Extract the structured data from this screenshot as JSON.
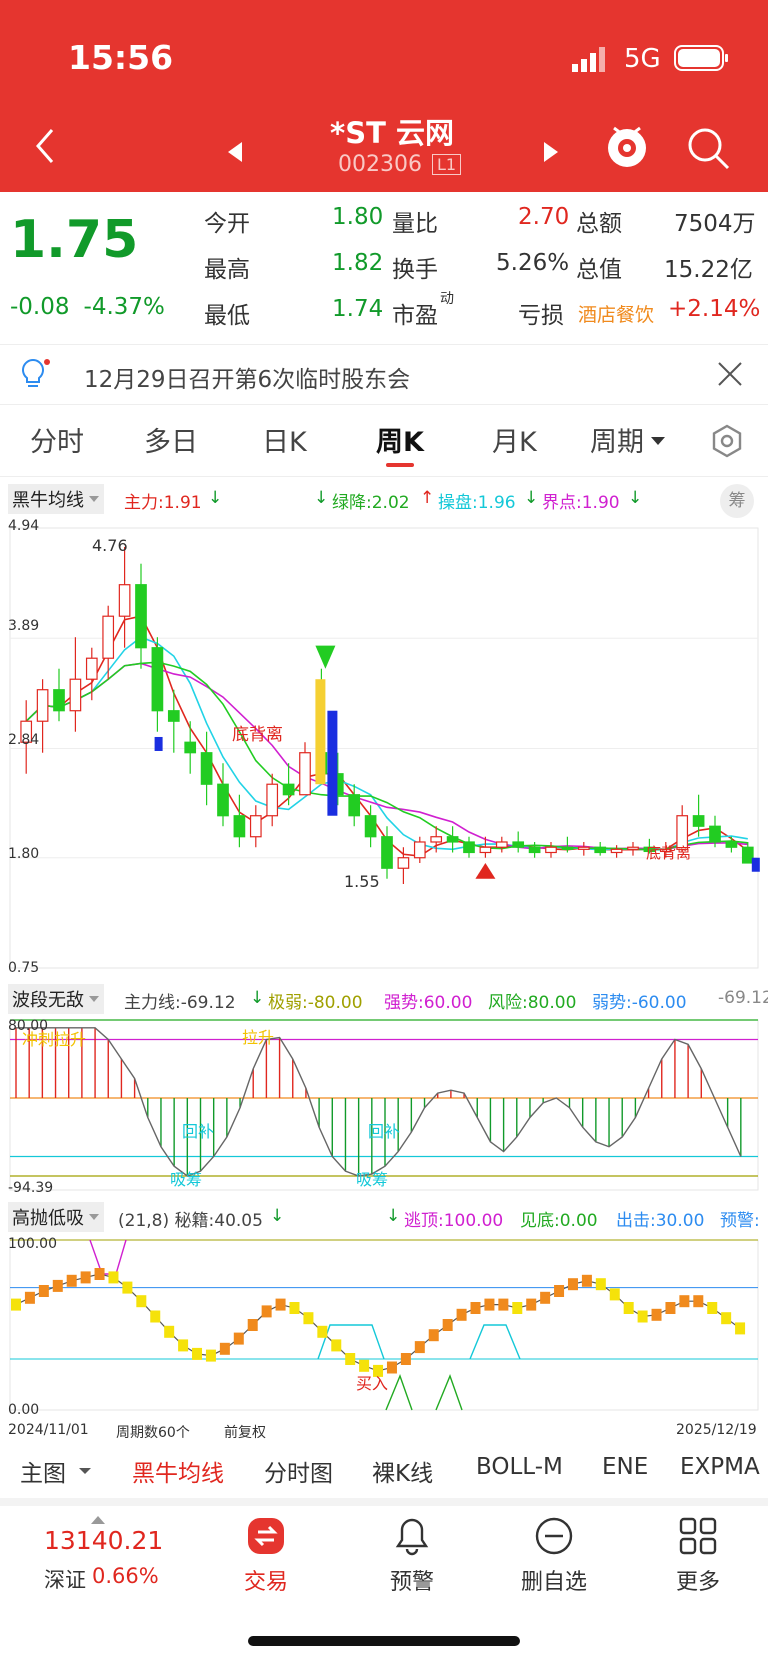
{
  "status": {
    "time": "15:56",
    "network": "5G"
  },
  "header": {
    "title": "*ST 云网",
    "code": "002306",
    "level": "L1"
  },
  "quote": {
    "price": "1.75",
    "change": "-0.08",
    "change_pct": "-4.37%",
    "open_label": "今开",
    "open": "1.80",
    "high_label": "最高",
    "high": "1.82",
    "low_label": "最低",
    "low": "1.74",
    "vr_label": "量比",
    "vr": "2.70",
    "turnover_label": "换手",
    "turnover": "5.26%",
    "pe_label": "市盈",
    "pe_sup": "动",
    "pe": "亏损",
    "amount_label": "总额",
    "amount": "7504万",
    "mcap_label": "总值",
    "mcap": "15.22亿",
    "sector": "酒店餐饮",
    "sector_pct": "+2.14%"
  },
  "notice": {
    "text": "12月29日召开第6次临时股东会"
  },
  "tabs": [
    "分时",
    "多日",
    "日K",
    "周K",
    "月K",
    "周期"
  ],
  "active_tab": 3,
  "main_chart": {
    "indicator": "黑牛均线",
    "zhuli": "主力:1.91",
    "lvjiang": "绿降:2.02",
    "caopan": "操盘:1.96",
    "jiedian": "界点:1.90",
    "chou": "筹",
    "y_labels": [
      "4.94",
      "3.89",
      "2.84",
      "1.80",
      "0.75"
    ],
    "high_mark": "4.76",
    "low_mark": "1.55",
    "annotations": [
      "底背离",
      "底背离"
    ]
  },
  "osc1": {
    "name": "波段无敌",
    "zhuli": "主力线:-69.12",
    "jiruo": "极弱:-80.00",
    "qiangshi": "强势:60.00",
    "fengxian": "风险:80.00",
    "ruoshi": "弱势:-60.00",
    "tail": "-69.12",
    "top": "80.00",
    "bottom": "-94.39",
    "tags": [
      "冲刺拉升",
      "拉升",
      "回补",
      "回补",
      "吸筹",
      "吸筹"
    ]
  },
  "osc2": {
    "name": "高抛低吸",
    "param": "(21,8) 秘籍:40.05",
    "taoding": "逃顶:100.00",
    "jiandi": "见底:0.00",
    "chuji": "出击:30.00",
    "yujing": "预警:",
    "top": "100.00",
    "bottom": "0.00",
    "tag": "买入"
  },
  "date_bar": {
    "start": "2024/11/01",
    "count": "周期数60个",
    "adj": "前复权",
    "end": "2025/12/19"
  },
  "indicator_tabs": [
    "主图",
    "黑牛均线",
    "分时图",
    "裸K线",
    "BOLL-M",
    "ENE",
    "EXPMA"
  ],
  "bottom_nav": {
    "index_value": "13140.21",
    "index_name": "深证",
    "index_pct": "0.66%",
    "trade": "交易",
    "alert": "预警",
    "remove": "删自选",
    "more": "更多"
  },
  "chart_data": {
    "type": "candlestick",
    "title": "*ST 云网 周K",
    "ylim": [
      0.75,
      4.94
    ],
    "ohlc": [
      [
        2.9,
        3.3,
        2.6,
        3.1
      ],
      [
        3.1,
        3.5,
        2.8,
        3.4
      ],
      [
        3.4,
        3.6,
        3.1,
        3.2
      ],
      [
        3.2,
        3.9,
        3.0,
        3.5
      ],
      [
        3.5,
        3.8,
        3.3,
        3.7
      ],
      [
        3.7,
        4.2,
        3.5,
        4.1
      ],
      [
        4.1,
        4.76,
        3.8,
        4.4
      ],
      [
        4.4,
        4.6,
        3.6,
        3.8
      ],
      [
        3.8,
        3.9,
        3.0,
        3.2
      ],
      [
        3.2,
        3.4,
        2.8,
        3.1
      ],
      [
        2.9,
        3.1,
        2.6,
        2.8
      ],
      [
        2.8,
        3.0,
        2.3,
        2.5
      ],
      [
        2.5,
        2.7,
        2.1,
        2.2
      ],
      [
        2.2,
        2.4,
        1.9,
        2.0
      ],
      [
        2.0,
        2.3,
        1.9,
        2.2
      ],
      [
        2.2,
        2.6,
        2.1,
        2.5
      ],
      [
        2.5,
        2.7,
        2.3,
        2.4
      ],
      [
        2.4,
        2.9,
        2.4,
        2.8
      ],
      [
        2.8,
        3.6,
        2.5,
        2.6
      ],
      [
        2.6,
        2.8,
        2.3,
        2.4
      ],
      [
        2.4,
        2.5,
        2.1,
        2.2
      ],
      [
        2.2,
        2.3,
        1.9,
        2.0
      ],
      [
        2.0,
        2.1,
        1.6,
        1.7
      ],
      [
        1.7,
        1.9,
        1.55,
        1.8
      ],
      [
        1.8,
        2.0,
        1.75,
        1.95
      ],
      [
        1.95,
        2.1,
        1.85,
        2.0
      ],
      [
        2.0,
        2.1,
        1.85,
        1.95
      ],
      [
        1.95,
        2.0,
        1.8,
        1.85
      ],
      [
        1.85,
        2.0,
        1.8,
        1.9
      ],
      [
        1.9,
        2.0,
        1.85,
        1.95
      ],
      [
        1.95,
        2.05,
        1.85,
        1.9
      ],
      [
        1.9,
        1.95,
        1.8,
        1.85
      ],
      [
        1.85,
        1.95,
        1.8,
        1.9
      ],
      [
        1.9,
        2.0,
        1.85,
        1.88
      ],
      [
        1.88,
        1.95,
        1.82,
        1.9
      ],
      [
        1.9,
        1.95,
        1.82,
        1.85
      ],
      [
        1.85,
        1.92,
        1.8,
        1.88
      ],
      [
        1.88,
        1.95,
        1.82,
        1.9
      ],
      [
        1.9,
        1.98,
        1.84,
        1.86
      ],
      [
        1.86,
        1.95,
        1.8,
        1.88
      ],
      [
        1.88,
        2.3,
        1.85,
        2.2
      ],
      [
        2.2,
        2.4,
        2.0,
        2.1
      ],
      [
        2.1,
        2.2,
        1.9,
        1.95
      ],
      [
        1.95,
        2.0,
        1.85,
        1.9
      ],
      [
        1.9,
        1.95,
        1.75,
        1.75
      ]
    ]
  }
}
